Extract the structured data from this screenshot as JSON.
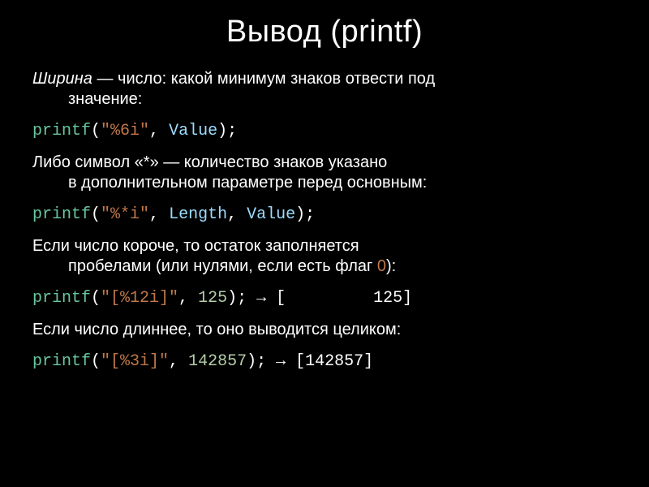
{
  "title": "Вывод (printf)",
  "p1_em": "Ширина",
  "p1_rest": " — число: какой минимум знаков отвести под",
  "p1_line2": "значение:",
  "code1": {
    "fn": "printf",
    "lp": "(",
    "str": "\"%6i\"",
    "c1": ", ",
    "arg": "Value",
    "rp": ")",
    "end": ";"
  },
  "p2_line1": "Либо символ «*» — количество знаков указано",
  "p2_line2": "в дополнительном параметре перед основным:",
  "code2": {
    "fn": "printf",
    "lp": "(",
    "str": "\"%*i\"",
    "c1": ", ",
    "arg1": "Length",
    "c2": ", ",
    "arg2": "Value",
    "rp": ")",
    "end": ";"
  },
  "p3_line1": "Если число короче, то остаток заполняется",
  "p3_line2a": "пробелами (или нулями, если есть флаг ",
  "p3_flag": "0",
  "p3_line2b": "):",
  "code3": {
    "fn": "printf",
    "lp": "(",
    "str": "\"[%12i]\"",
    "c1": ", ",
    "num": "125",
    "rp": ")",
    "end": ";",
    "arrow": " → ",
    "out": "[         125]"
  },
  "p4": "Если число длиннее, то оно выводится целиком:",
  "code4": {
    "fn": "printf",
    "lp": "(",
    "str": "\"[%3i]\"",
    "c1": ", ",
    "num": "142857",
    "rp": ")",
    "end": ";",
    "arrow": " → ",
    "out": "[142857]"
  }
}
